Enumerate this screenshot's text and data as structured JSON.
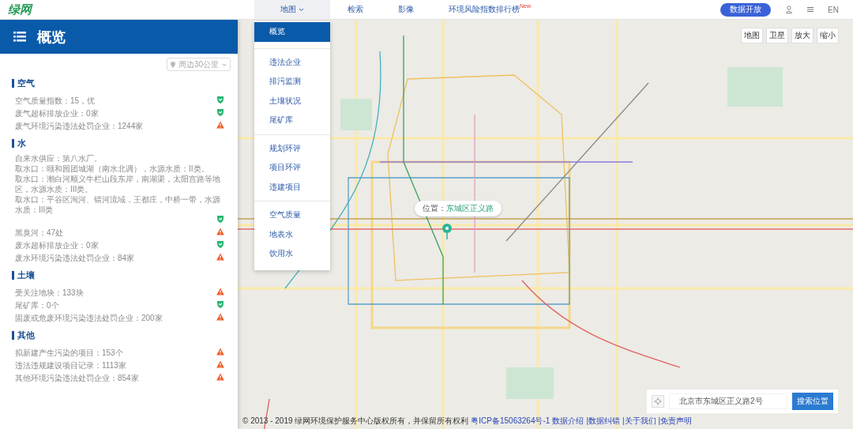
{
  "logo": {
    "text": "绿网"
  },
  "nav": [
    {
      "label": "地图",
      "selected": true,
      "dropdown": true
    },
    {
      "label": "检索",
      "selected": false
    },
    {
      "label": "影像",
      "selected": false
    },
    {
      "label": "环境风险指数排行榜",
      "selected": false,
      "badge": "New"
    }
  ],
  "header_actions": {
    "button": "数据开放",
    "language": "EN"
  },
  "panel": {
    "title": "概览",
    "range_select": "周边30公里",
    "sections": [
      {
        "title": "空气",
        "items": [
          {
            "lines": [
              "空气质量指数：15，优"
            ],
            "kind": "good"
          },
          {
            "lines": [
              "废气超标排放企业：0家"
            ],
            "kind": "good"
          },
          {
            "lines": [
              "废气环境污染违法处罚企业：1244家"
            ],
            "kind": "warn"
          }
        ]
      },
      {
        "title": "水",
        "items": [
          {
            "lines": [
              "自来水供应：第八水厂。",
              "取水口：颐和园团城湖（南水北调），水源水质：II类。",
              "取水口：潮白河顺义牛栏山段东岸，南湖渠，太阳宫路等地区，水源水质：III类。",
              "取水口：平谷区洵河、错河流域，王都庄，中桥一带，水源水质：III类"
            ],
            "kind": "good"
          },
          {
            "lines": [
              "黑臭河：47处"
            ],
            "kind": "warn"
          },
          {
            "lines": [
              "废水超标排放企业：0家"
            ],
            "kind": "good"
          },
          {
            "lines": [
              "废水环境污染违法处罚企业：84家"
            ],
            "kind": "warn"
          }
        ]
      },
      {
        "title": "土壤",
        "items": [
          {
            "lines": [
              "受关注地块：133块"
            ],
            "kind": "warn"
          },
          {
            "lines": [
              "尾矿库：0个"
            ],
            "kind": "good"
          },
          {
            "lines": [
              "固废或危废环境污染违法处罚企业：200家"
            ],
            "kind": "warn"
          }
        ]
      },
      {
        "title": "其他",
        "items": [
          {
            "lines": [
              "拟新建产生污染的项目：153个"
            ],
            "kind": "warn"
          },
          {
            "lines": [
              "违法违规建设项目记录：1113家"
            ],
            "kind": "warn"
          },
          {
            "lines": [
              "其他环境污染违法处罚企业：854家"
            ],
            "kind": "warn"
          }
        ]
      }
    ]
  },
  "menu": [
    [
      {
        "label": "概览",
        "selected": true
      }
    ],
    [
      {
        "label": "违法企业",
        "selected": false
      },
      {
        "label": "排污监测",
        "selected": false
      },
      {
        "label": "土壤状况",
        "selected": false
      },
      {
        "label": "尾矿库",
        "selected": false
      }
    ],
    [
      {
        "label": "规划环评",
        "selected": false
      },
      {
        "label": "项目环评",
        "selected": false
      },
      {
        "label": "违建项目",
        "selected": false
      }
    ],
    [
      {
        "label": "空气质量",
        "selected": false
      },
      {
        "label": "地表水",
        "selected": false
      },
      {
        "label": "饮用水",
        "selected": false
      }
    ]
  ],
  "map_controls": [
    "地图",
    "卫星",
    "放大",
    "缩小"
  ],
  "popup": {
    "label": "位置：",
    "value": "东城区正义路"
  },
  "location_search": {
    "value": "北京市东城区正义路2号",
    "button": "搜索位置"
  },
  "footer": {
    "copyright": "© 2013 - 2019 绿网环境保护服务中心版权所有，并保留所有权利",
    "links": [
      "粤ICP备15063264号-1",
      "数据介绍",
      "|数据纠错",
      "|关于我们",
      "|免责声明"
    ]
  }
}
